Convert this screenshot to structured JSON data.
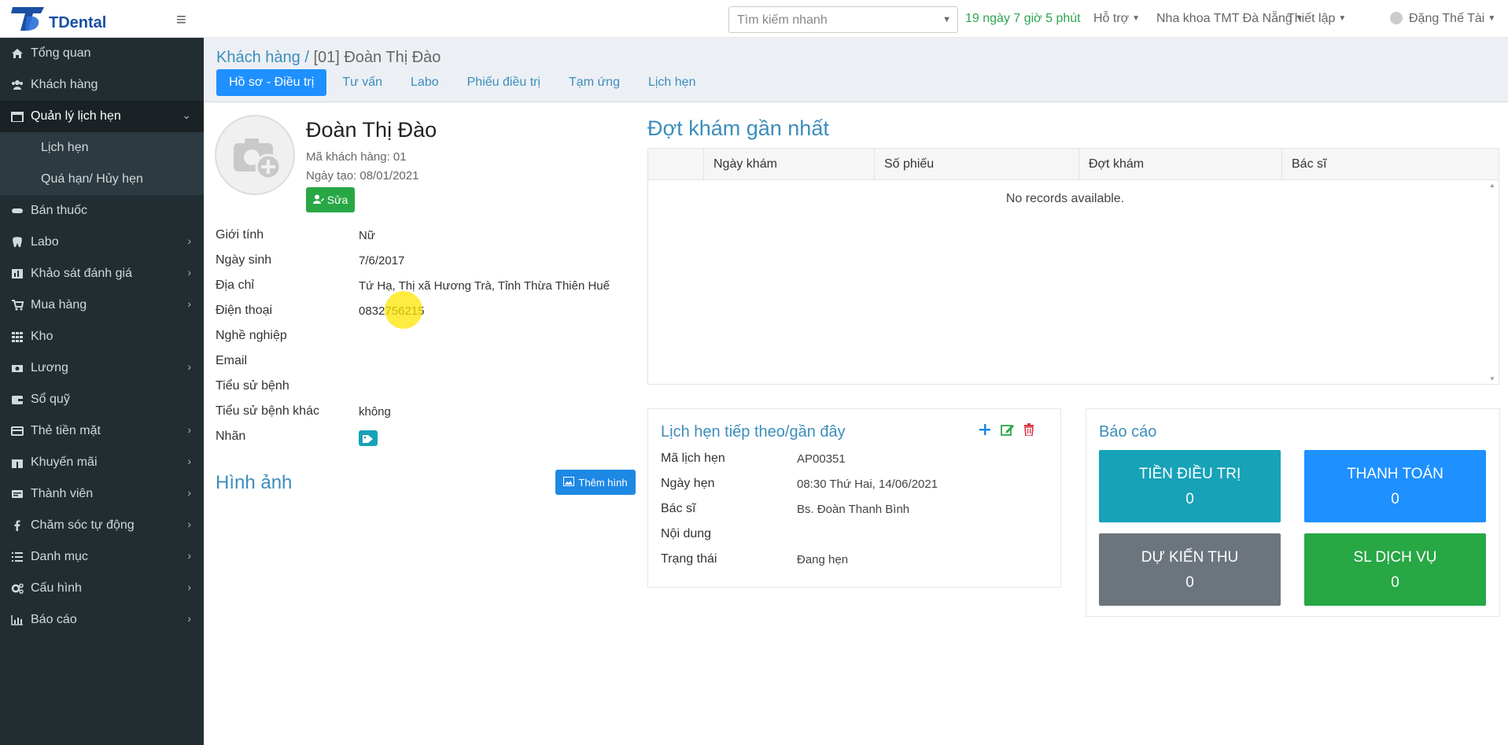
{
  "brand": {
    "name": "TDental"
  },
  "topbar": {
    "search_placeholder": "Tìm kiếm nhanh",
    "timer": "19 ngày 7 giờ 5 phút",
    "support": "Hỗ trợ",
    "branch": "Nha khoa TMT Đà Nẵng",
    "settings": "Thiết lập",
    "user": "Đặng Thế Tài"
  },
  "sidebar": {
    "items": [
      {
        "label": "Tổng quan",
        "icon": "home-icon"
      },
      {
        "label": "Khách hàng",
        "icon": "users-icon"
      },
      {
        "label": "Quản lý lịch hẹn",
        "icon": "calendar-icon"
      },
      {
        "label": "Lịch hẹn"
      },
      {
        "label": "Quá hạn/ Hủy hẹn"
      },
      {
        "label": "Bán thuốc",
        "icon": "pills-icon"
      },
      {
        "label": "Labo",
        "icon": "tooth-icon"
      },
      {
        "label": "Khảo sát đánh giá",
        "icon": "chart-icon"
      },
      {
        "label": "Mua hàng",
        "icon": "cart-icon"
      },
      {
        "label": "Kho",
        "icon": "grid-icon"
      },
      {
        "label": "Lương",
        "icon": "money-icon"
      },
      {
        "label": "Sổ quỹ",
        "icon": "wallet-icon"
      },
      {
        "label": "Thẻ tiền mặt",
        "icon": "card-icon"
      },
      {
        "label": "Khuyến mãi",
        "icon": "gift-icon"
      },
      {
        "label": "Thành viên",
        "icon": "member-card-icon"
      },
      {
        "label": "Chăm sóc tự động",
        "icon": "facebook-icon"
      },
      {
        "label": "Danh mục",
        "icon": "list-icon"
      },
      {
        "label": "Cấu hình",
        "icon": "cogs-icon"
      },
      {
        "label": "Báo cáo",
        "icon": "bar-chart-icon"
      }
    ]
  },
  "breadcrumb": {
    "parent": "Khách hàng /",
    "current": "[01] Đoàn Thị Đào"
  },
  "tabs": [
    "Hồ sơ - Điều trị",
    "Tư vấn",
    "Labo",
    "Phiếu điều trị",
    "Tạm ứng",
    "Lịch hẹn"
  ],
  "profile": {
    "name": "Đoàn Thị Đào",
    "code": "Mã khách hàng: 01",
    "created": "Ngày tạo: 08/01/2021",
    "edit_label": "Sửa",
    "fields": [
      {
        "label": "Giới tính",
        "value": "Nữ"
      },
      {
        "label": "Ngày sinh",
        "value": "7/6/2017"
      },
      {
        "label": "Địa chỉ",
        "value": "Tứ Hạ, Thị xã Hương Trà, Tỉnh Thừa Thiên Huế"
      },
      {
        "label": "Điện thoại",
        "value": "0832756215"
      },
      {
        "label": "Nghề nghiệp",
        "value": ""
      },
      {
        "label": "Email",
        "value": ""
      },
      {
        "label": "Tiểu sử bệnh",
        "value": ""
      },
      {
        "label": "Tiểu sử bệnh khác",
        "value": "không"
      },
      {
        "label": "Nhãn",
        "value": ""
      }
    ]
  },
  "images": {
    "title": "Hình ảnh",
    "add_label": "Thêm hình"
  },
  "latest_visit": {
    "title": "Đợt khám gần nhất",
    "columns": [
      "Ngày khám",
      "Số phiếu",
      "Đợt khám",
      "Bác sĩ"
    ],
    "empty": "No records available."
  },
  "appointment": {
    "title": "Lịch hẹn tiếp theo/gần đây",
    "rows": [
      {
        "label": "Mã lịch hẹn",
        "value": "AP00351"
      },
      {
        "label": "Ngày hẹn",
        "value": "08:30 Thứ Hai, 14/06/2021"
      },
      {
        "label": "Bác sĩ",
        "value": "Bs. Đoàn Thanh Bình"
      },
      {
        "label": "Nội dung",
        "value": ""
      },
      {
        "label": "Trạng thái",
        "value": "Đang hẹn"
      }
    ]
  },
  "report": {
    "title": "Báo cáo",
    "cards": [
      {
        "label": "TIỀN ĐIỀU TRỊ",
        "value": "0",
        "color": "#17a2b8"
      },
      {
        "label": "THANH TOÁN",
        "value": "0",
        "color": "#1e90ff"
      },
      {
        "label": "DỰ KIẾN THU",
        "value": "0",
        "color": "#6c757d"
      },
      {
        "label": "SL DỊCH VỤ",
        "value": "0",
        "color": "#28a745"
      }
    ]
  }
}
